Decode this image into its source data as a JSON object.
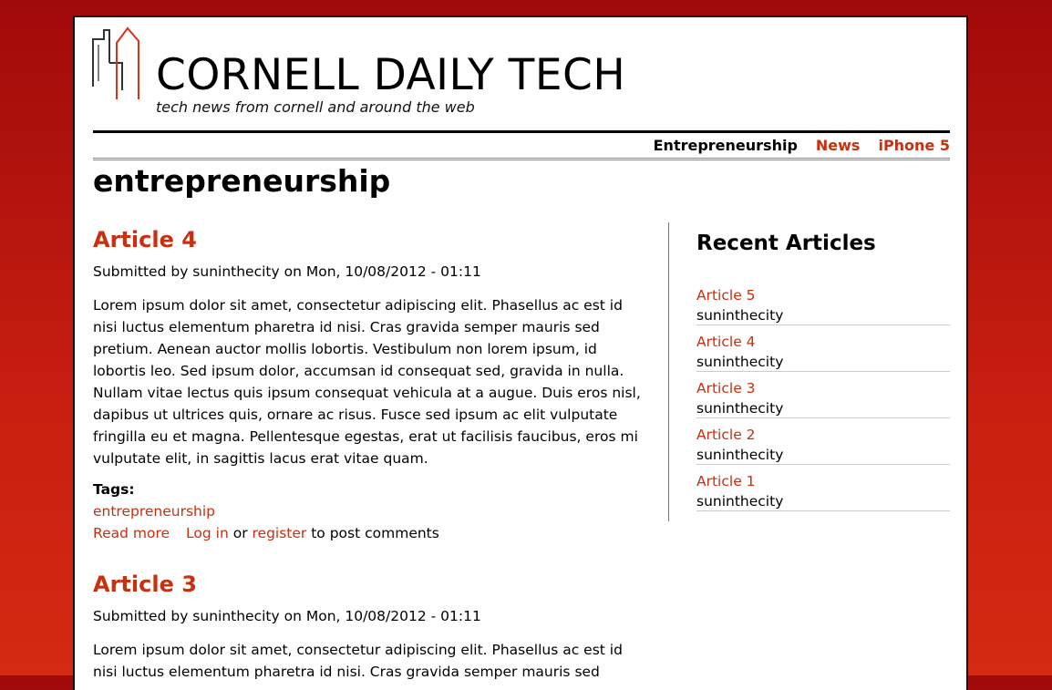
{
  "site": {
    "name": "CORNELL DAILY TECH",
    "slogan": "tech news from cornell and around the web"
  },
  "nav": {
    "items": [
      {
        "label": "Entrepreneurship",
        "active": true
      },
      {
        "label": "News",
        "active": false
      },
      {
        "label": "iPhone 5",
        "active": false
      }
    ]
  },
  "page": {
    "title": "entrepreneurship"
  },
  "articles": [
    {
      "title": "Article 4",
      "submitted": "Submitted by suninthecity on Mon, 10/08/2012 - 01:11",
      "body": "Lorem ipsum dolor sit amet, consectetur adipiscing elit. Phasellus ac est id nisi luctus elementum pharetra id nisi. Cras gravida semper mauris sed pretium. Aenean auctor mollis lobortis. Vestibulum non lorem ipsum, id lobortis leo. Sed ipsum dolor, accumsan id consequat sed, gravida in nulla. Nullam vitae lectus quis ipsum consequat vehicula at a augue. Duis eros nisl, dapibus ut ultrices quis, ornare ac risus. Fusce sed ipsum ac elit vulputate fringilla eu et magna. Pellentesque egestas, erat ut facilisis faucibus, eros mi vulputate elit, in sagittis lacus erat vitae quam.",
      "tags_label": "Tags:",
      "tag": "entrepreneurship",
      "read_more": "Read more",
      "login": "Log in",
      "or": "or",
      "register": "register",
      "post_comments": "to post comments"
    },
    {
      "title": "Article 3",
      "submitted": "Submitted by suninthecity on Mon, 10/08/2012 - 01:11",
      "body": "Lorem ipsum dolor sit amet, consectetur adipiscing elit. Phasellus ac est id nisi luctus elementum pharetra id nisi. Cras gravida semper mauris sed"
    }
  ],
  "sidebar": {
    "title": "Recent Articles",
    "items": [
      {
        "title": "Article 5",
        "author": "suninthecity"
      },
      {
        "title": "Article 4",
        "author": "suninthecity"
      },
      {
        "title": "Article 3",
        "author": "suninthecity"
      },
      {
        "title": "Article 2",
        "author": "suninthecity"
      },
      {
        "title": "Article 1",
        "author": "suninthecity"
      }
    ]
  },
  "colors": {
    "accent": "#c8300f",
    "background_top": "#a00a0a",
    "background_bottom": "#d42a12"
  },
  "icons": {
    "logo": "building-skyline-icon"
  }
}
